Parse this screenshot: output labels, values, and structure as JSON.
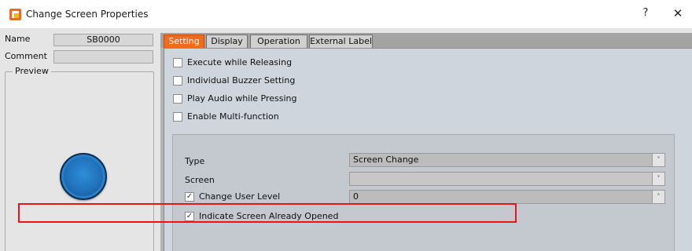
{
  "window": {
    "title": "Change Screen Properties",
    "help_glyph": "?",
    "close_glyph": "✕"
  },
  "left": {
    "name_label": "Name",
    "name_value": "SB0000",
    "comment_label": "Comment",
    "comment_value": "",
    "preview_label": "Preview"
  },
  "tabs": [
    {
      "label": "Setting",
      "active": true
    },
    {
      "label": "Display",
      "active": false
    },
    {
      "label": "Operation",
      "active": false
    },
    {
      "label": "External Label",
      "active": false
    }
  ],
  "options": [
    {
      "label": "Execute while Releasing",
      "checked": false
    },
    {
      "label": "Individual Buzzer Setting",
      "checked": false
    },
    {
      "label": "Play Audio while Pressing",
      "checked": false
    },
    {
      "label": "Enable Multi-function",
      "checked": false
    }
  ],
  "fields": {
    "type": {
      "label": "Type",
      "value": "Screen Change"
    },
    "screen": {
      "label": "Screen",
      "value": ""
    },
    "user_level": {
      "label": "Change User Level",
      "checked": true,
      "value": "0"
    },
    "indicate": {
      "label": "Indicate Screen Already Opened",
      "checked": true
    }
  },
  "icons": {
    "dropdown": "˅",
    "spin_up": "˄",
    "check": "✓"
  },
  "colors": {
    "active_tab": "#f26a1b",
    "highlight": "#e3161c",
    "preview_button": "#1f6fb8"
  }
}
